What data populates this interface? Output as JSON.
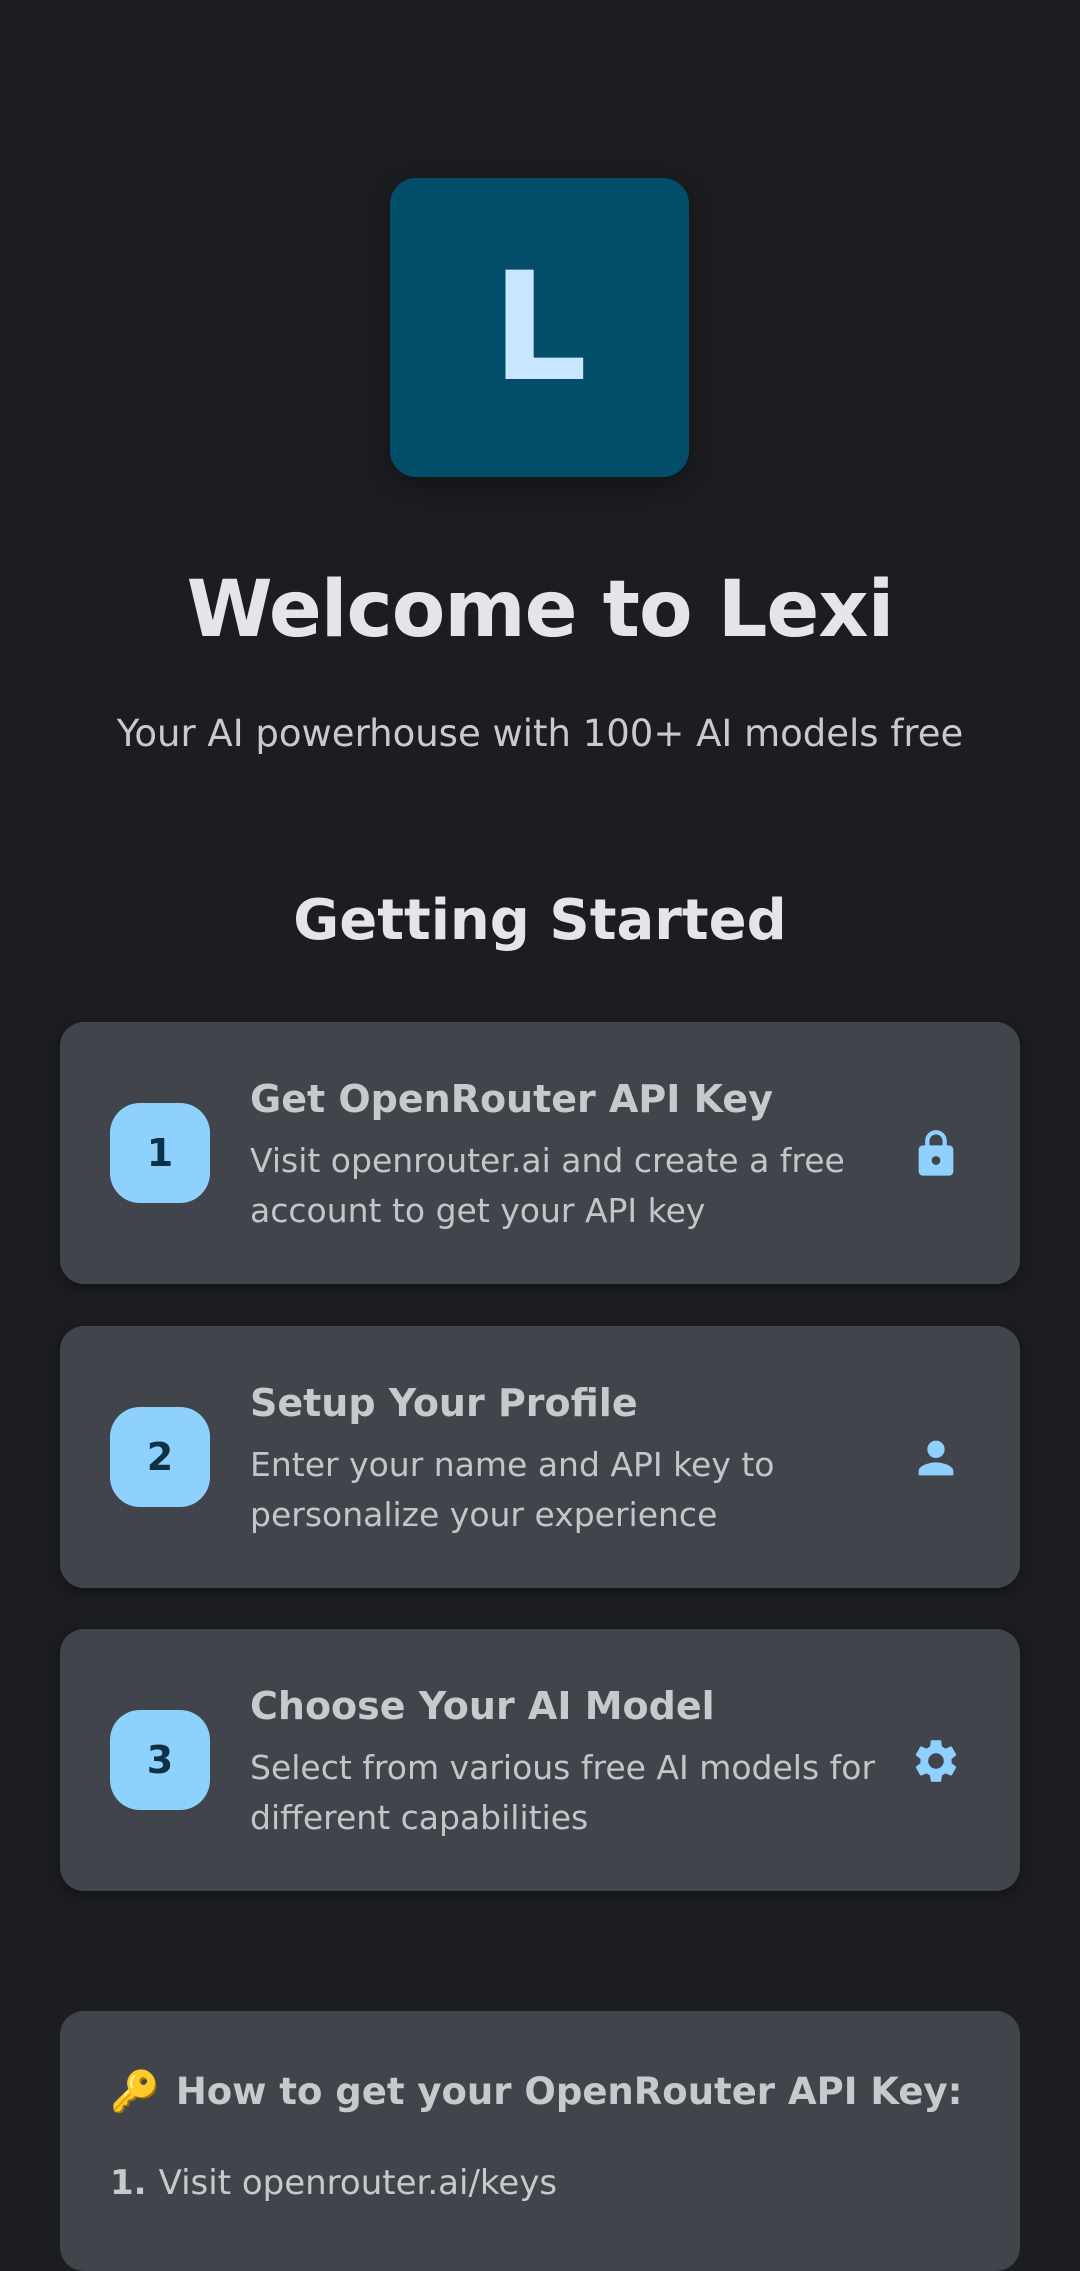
{
  "logo": {
    "letter": "L"
  },
  "header": {
    "title": "Welcome to Lexi",
    "subtitle": "Your AI powerhouse with 100+ AI models free"
  },
  "getting_started": {
    "title": "Getting Started",
    "steps": [
      {
        "number": "1",
        "title": "Get OpenRouter API Key",
        "description": "Visit openrouter.ai and create a free account to get your API key",
        "icon": "lock-icon"
      },
      {
        "number": "2",
        "title": "Setup Your Profile",
        "description": "Enter your name and API key to personalize your experience",
        "icon": "person-icon"
      },
      {
        "number": "3",
        "title": "Choose Your AI Model",
        "description": "Select from various free AI models for different capabilities",
        "icon": "gear-icon"
      }
    ]
  },
  "api_help": {
    "icon": "🔑",
    "heading": "How to get your OpenRouter API Key:",
    "items": [
      {
        "number": "1.",
        "text": "Visit openrouter.ai/keys"
      }
    ]
  },
  "colors": {
    "background": "#1b1d20",
    "card": "#41454b",
    "accent": "#8ed1ff",
    "logo_bg": "#024d6a"
  }
}
